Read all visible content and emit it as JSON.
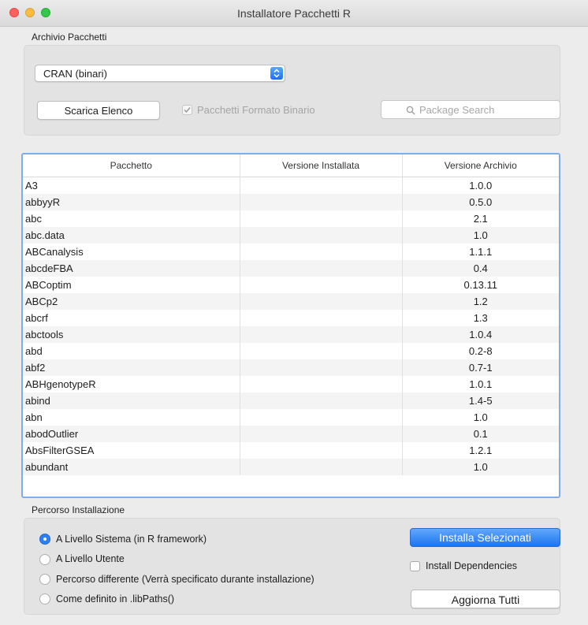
{
  "window": {
    "title": "Installatore Pacchetti R"
  },
  "archive": {
    "label": "Archivio Pacchetti",
    "repository": "CRAN (binari)",
    "download_button": "Scarica Elenco",
    "binary_format_label": "Pacchetti Formato Binario",
    "binary_format_checked": true,
    "search_placeholder": "Package Search"
  },
  "table": {
    "headers": [
      "Pacchetto",
      "Versione Installata",
      "Versione Archivio"
    ],
    "rows": [
      {
        "name": "A3",
        "installed": "",
        "archive": "1.0.0"
      },
      {
        "name": "abbyyR",
        "installed": "",
        "archive": "0.5.0"
      },
      {
        "name": "abc",
        "installed": "",
        "archive": "2.1"
      },
      {
        "name": "abc.data",
        "installed": "",
        "archive": "1.0"
      },
      {
        "name": "ABCanalysis",
        "installed": "",
        "archive": "1.1.1"
      },
      {
        "name": "abcdeFBA",
        "installed": "",
        "archive": "0.4"
      },
      {
        "name": "ABCoptim",
        "installed": "",
        "archive": "0.13.11"
      },
      {
        "name": "ABCp2",
        "installed": "",
        "archive": "1.2"
      },
      {
        "name": "abcrf",
        "installed": "",
        "archive": "1.3"
      },
      {
        "name": "abctools",
        "installed": "",
        "archive": "1.0.4"
      },
      {
        "name": "abd",
        "installed": "",
        "archive": "0.2-8"
      },
      {
        "name": "abf2",
        "installed": "",
        "archive": "0.7-1"
      },
      {
        "name": "ABHgenotypeR",
        "installed": "",
        "archive": "1.0.1"
      },
      {
        "name": "abind",
        "installed": "",
        "archive": "1.4-5"
      },
      {
        "name": "abn",
        "installed": "",
        "archive": "1.0"
      },
      {
        "name": "abodOutlier",
        "installed": "",
        "archive": "0.1"
      },
      {
        "name": "AbsFilterGSEA",
        "installed": "",
        "archive": "1.2.1"
      },
      {
        "name": "abundant",
        "installed": "",
        "archive": "1.0"
      }
    ]
  },
  "install": {
    "label": "Percorso Installazione",
    "options": [
      {
        "label": "A Livello Sistema (in R framework)",
        "selected": true
      },
      {
        "label": "A Livello Utente",
        "selected": false
      },
      {
        "label": "Percorso differente (Verrà specificato durante installazione)",
        "selected": false
      },
      {
        "label": "Come definito in .libPaths()",
        "selected": false
      }
    ],
    "install_selected_button": "Installa Selezionati",
    "dependencies_label": "Install Dependencies",
    "dependencies_checked": false,
    "update_all_button": "Aggiorna Tutti"
  },
  "colors": {
    "accent": "#1b74f1",
    "table_focus": "#7eaeea"
  }
}
